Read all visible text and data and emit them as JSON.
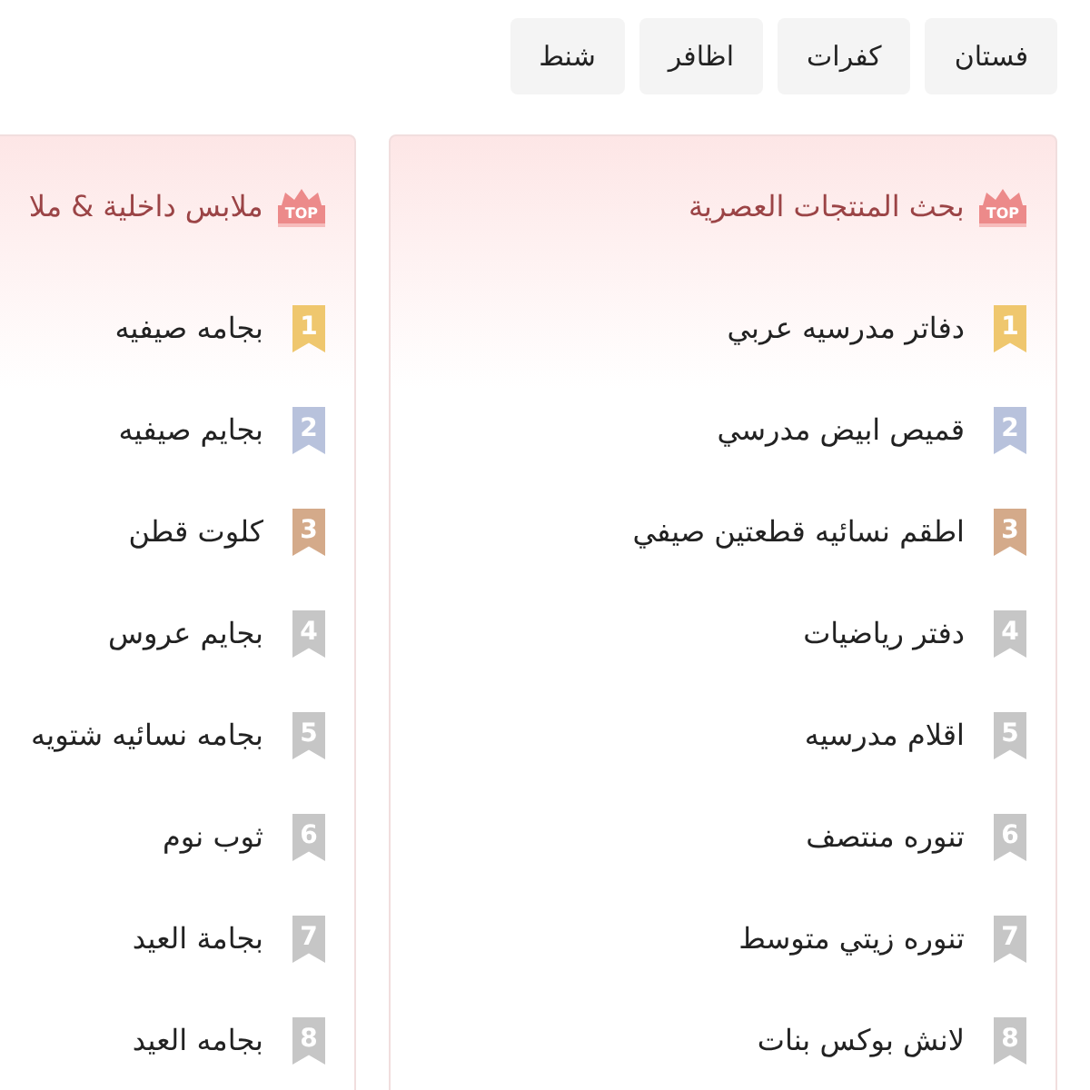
{
  "tags": [
    {
      "label": "فستان"
    },
    {
      "label": "كفرات"
    },
    {
      "label": "اظافر"
    },
    {
      "label": "شنط"
    }
  ],
  "panels": [
    {
      "badge": "TOP",
      "title": "بحث المنتجات العصرية",
      "items": [
        {
          "rank": "1",
          "label": "دفاتر مدرسيه عربي",
          "color": "#efc76e"
        },
        {
          "rank": "2",
          "label": "قميص ابيض مدرسي",
          "color": "#b8c2dc"
        },
        {
          "rank": "3",
          "label": "اطقم نسائيه قطعتين صيفي",
          "color": "#d4aa8a"
        },
        {
          "rank": "4",
          "label": "دفتر رياضيات",
          "color": "#c6c6c6"
        },
        {
          "rank": "5",
          "label": "اقلام مدرسيه",
          "color": "#c6c6c6"
        },
        {
          "rank": "6",
          "label": "تنوره منتصف",
          "color": "#c6c6c6"
        },
        {
          "rank": "7",
          "label": "تنوره زيتي متوسط",
          "color": "#c6c6c6"
        },
        {
          "rank": "8",
          "label": "لانش بوكس بنات",
          "color": "#c6c6c6"
        }
      ]
    },
    {
      "badge": "TOP",
      "title": "ملابس داخلية & ملا",
      "items": [
        {
          "rank": "1",
          "label": "بجامه صيفيه",
          "color": "#efc76e"
        },
        {
          "rank": "2",
          "label": "بجايم صيفيه",
          "color": "#b8c2dc"
        },
        {
          "rank": "3",
          "label": "كلوت قطن",
          "color": "#d4aa8a"
        },
        {
          "rank": "4",
          "label": "بجايم عروس",
          "color": "#c6c6c6"
        },
        {
          "rank": "5",
          "label": "بجامه نسائيه شتويه",
          "color": "#c6c6c6"
        },
        {
          "rank": "6",
          "label": "ثوب نوم",
          "color": "#c6c6c6"
        },
        {
          "rank": "7",
          "label": "بجامة العيد",
          "color": "#c6c6c6"
        },
        {
          "rank": "8",
          "label": "بجامه العيد",
          "color": "#c6c6c6"
        }
      ]
    }
  ]
}
